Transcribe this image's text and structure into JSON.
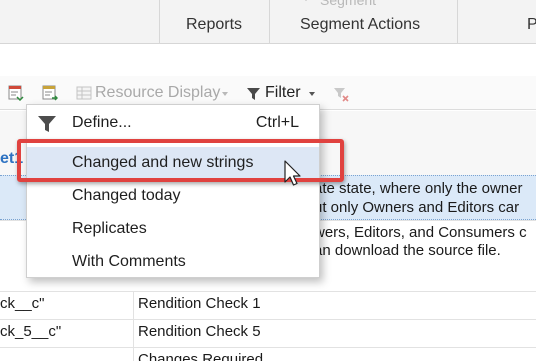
{
  "ribbon": {
    "faded_label": "Segment",
    "groups": [
      "Reports",
      "Segment Actions",
      "P"
    ]
  },
  "toolbar": {
    "resource_display": "Resource Display",
    "filter": "Filter"
  },
  "background": {
    "sheet_tab": "et1",
    "row_text": [
      "ate state, where only the owner",
      "ut only Owners and Editors car",
      "wers, Editors, and Consumers c",
      "an download the source file."
    ],
    "table_rows": [
      {
        "key": "ck__c\"",
        "value": "Rendition Check 1"
      },
      {
        "key": "ck_5__c\"",
        "value": "Rendition Check 5"
      },
      {
        "key": "",
        "value": "Changes Required"
      }
    ]
  },
  "filter_menu": {
    "define_label": "Define...",
    "define_shortcut": "Ctrl+L",
    "items": [
      "Changed and new strings",
      "Changed today",
      "Replicates",
      "With Comments"
    ]
  },
  "colors": {
    "highlight": "#e0423f",
    "accent_blue": "#2f73c2",
    "selection": "#dbe9f8"
  },
  "icons": [
    "import-icon",
    "export-icon",
    "resource-display-icon",
    "filter-icon",
    "clear-filter-icon",
    "funnel-icon",
    "mouse-cursor-icon"
  ]
}
